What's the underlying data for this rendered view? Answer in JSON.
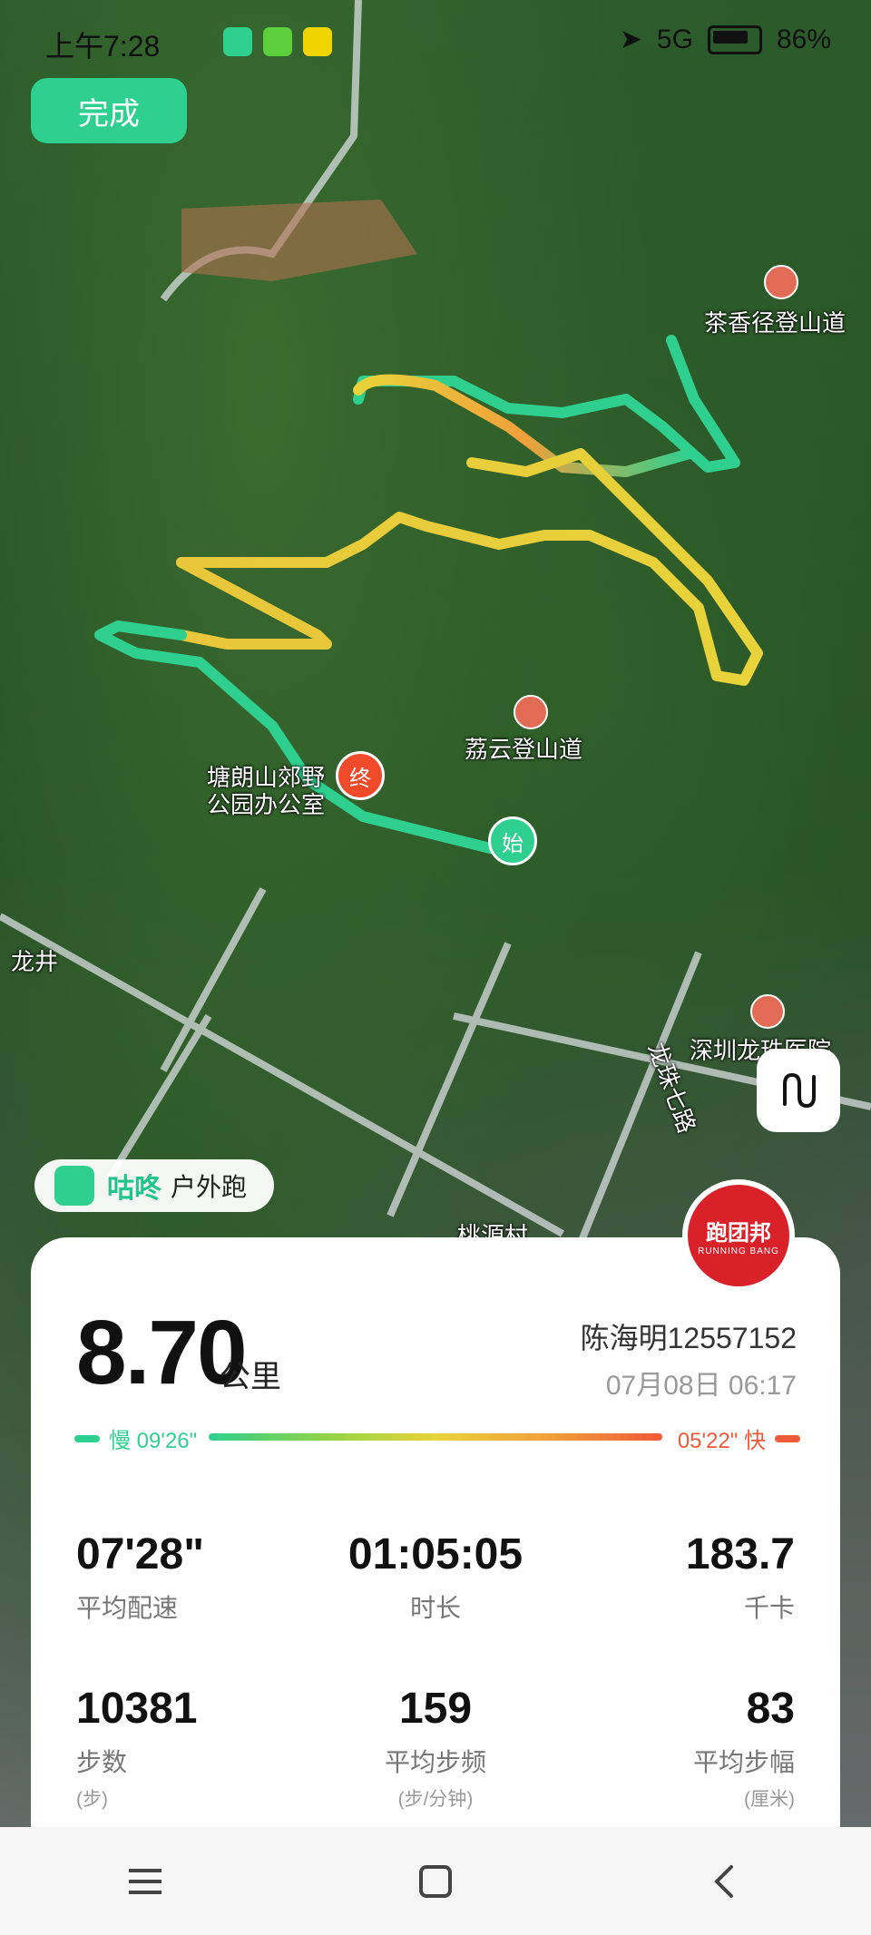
{
  "status_bar": {
    "time": "上午7:28",
    "network": "5G",
    "battery": "86%"
  },
  "done_button": {
    "label": "完成"
  },
  "map": {
    "labels": {
      "trail_tea": "茶香径登山道",
      "trail_lychee": "荔云登山道",
      "park_office": "塘朗山郊野\n公园办公室",
      "longjing": "龙井",
      "hospital": "深圳龙珠医院",
      "road": "龙珠七路",
      "taoyuan": "桃源村"
    },
    "markers": {
      "end": "终",
      "start": "始"
    }
  },
  "gudong": {
    "name": "咕咚",
    "type": "户外跑"
  },
  "paotuanbang": {
    "title": "跑团邦",
    "subtitle": "RUNNING BANG"
  },
  "summary": {
    "distance": "8.70",
    "distance_unit": "公里",
    "user": "陈海明12557152",
    "date": "07月08日 06:17"
  },
  "pace_legend": {
    "slow_label": "慢 09'26\"",
    "fast_label": "05'22\" 快",
    "slow_color": "#2fd08f",
    "fast_color": "#ef5a3a"
  },
  "stats": {
    "avg_pace": {
      "value": "07'28\"",
      "label": "平均配速"
    },
    "duration": {
      "value": "01:05:05",
      "label": "时长"
    },
    "calories": {
      "value": "183.7",
      "label": "千卡"
    },
    "steps": {
      "value": "10381",
      "label": "步数",
      "unit": "(步)"
    },
    "cadence": {
      "value": "159",
      "label": "平均步频",
      "unit": "(步/分钟)"
    },
    "stride": {
      "value": "83",
      "label": "平均步幅",
      "unit": "(厘米)"
    }
  }
}
